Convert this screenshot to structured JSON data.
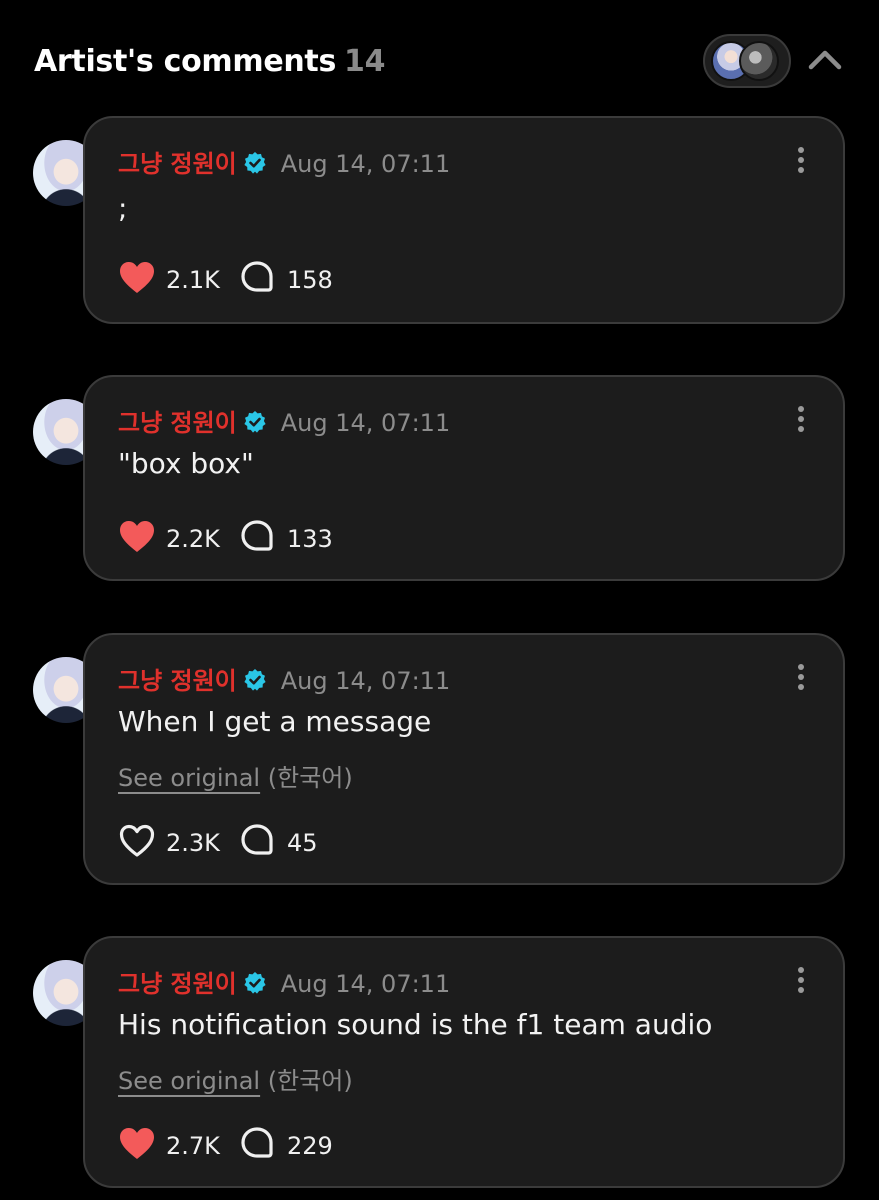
{
  "header": {
    "title": "Artist's comments",
    "count": "14"
  },
  "colors": {
    "author": "#e0312c",
    "verified": "#2ac6e6",
    "liked_heart": "#f35a5a",
    "card_bg": "#1c1c1c"
  },
  "icons": [
    "chevron-up-icon",
    "verified-icon",
    "more-vertical-icon",
    "heart-icon",
    "comment-icon"
  ],
  "comments": [
    {
      "author": "그냥 정원이",
      "date": "Aug 14, 07:11",
      "text": ";",
      "likes": "2.1K",
      "replies": "158",
      "liked": true,
      "translated": false
    },
    {
      "author": "그냥 정원이",
      "date": "Aug 14, 07:11",
      "text": "\"box box\"",
      "likes": "2.2K",
      "replies": "133",
      "liked": true,
      "translated": false
    },
    {
      "author": "그냥 정원이",
      "date": "Aug 14, 07:11",
      "text": "When I get a message",
      "see_original": "See original",
      "language": "(한국어)",
      "likes": "2.3K",
      "replies": "45",
      "liked": false,
      "translated": true
    },
    {
      "author": "그냥 정원이",
      "date": "Aug 14, 07:11",
      "text": "His notification sound is the f1 team audio",
      "see_original": "See original",
      "language": "(한국어)",
      "likes": "2.7K",
      "replies": "229",
      "liked": true,
      "translated": true
    }
  ]
}
